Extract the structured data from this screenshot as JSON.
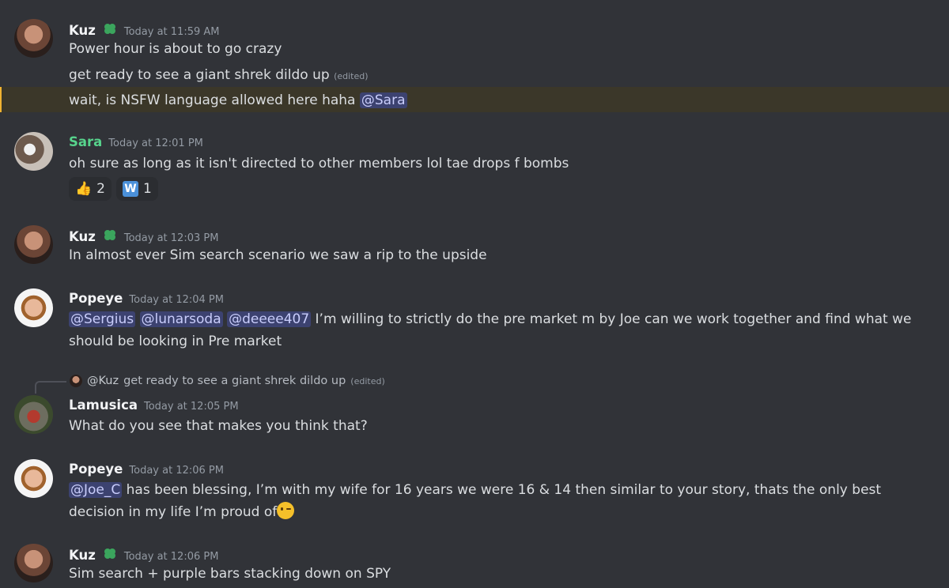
{
  "messages": {
    "m1": {
      "author": "Kuz",
      "time": "Today at 11:59 AM",
      "lines": [
        "Power hour is about to go crazy",
        "get ready to see a giant shrek dildo up"
      ],
      "edited": "(edited)",
      "line3_text": "wait, is NSFW language allowed here haha ",
      "line3_mention": "@Sara"
    },
    "m2": {
      "author": "Sara",
      "time": "Today at 12:01 PM",
      "text": "oh sure as long as it isn't directed to other members lol tae drops f bombs",
      "reactions": [
        {
          "emoji": "👍",
          "count": "2"
        },
        {
          "emoji": "W",
          "count": "1"
        }
      ]
    },
    "m3": {
      "author": "Kuz",
      "time": "Today at 12:03 PM",
      "text": "In almost ever Sim search scenario we saw a rip to the upside"
    },
    "m4": {
      "author": "Popeye",
      "time": "Today at 12:04 PM",
      "mentions": [
        "@Sergius",
        "@lunarsoda",
        "@deeee407"
      ],
      "text": " I’m willing to strictly do the pre market m by Joe can we work together and find what we should be looking in Pre market"
    },
    "m5": {
      "reply_author": "@Kuz",
      "reply_text": "get ready to see a giant shrek dildo up",
      "reply_edited": "(edited)",
      "author": "Lamusica",
      "time": "Today at 12:05 PM",
      "text": "What do you see that makes you think that?"
    },
    "m6": {
      "author": "Popeye",
      "time": "Today at 12:06 PM",
      "mention": "@Joe_C",
      "text": " has been blessing, I’m with my wife for 16 years we were 16 & 14 then similar to your story, thats the only best decision in my life I’m proud of"
    },
    "m7": {
      "author": "Kuz",
      "time": "Today at 12:06 PM",
      "text": "Sim search + purple bars stacking down on SPY"
    }
  },
  "colors": {
    "background": "#313338",
    "mention_bg": "#3c4270",
    "highlight_bg": "#3b3729",
    "sara_name": "#57d38c"
  }
}
